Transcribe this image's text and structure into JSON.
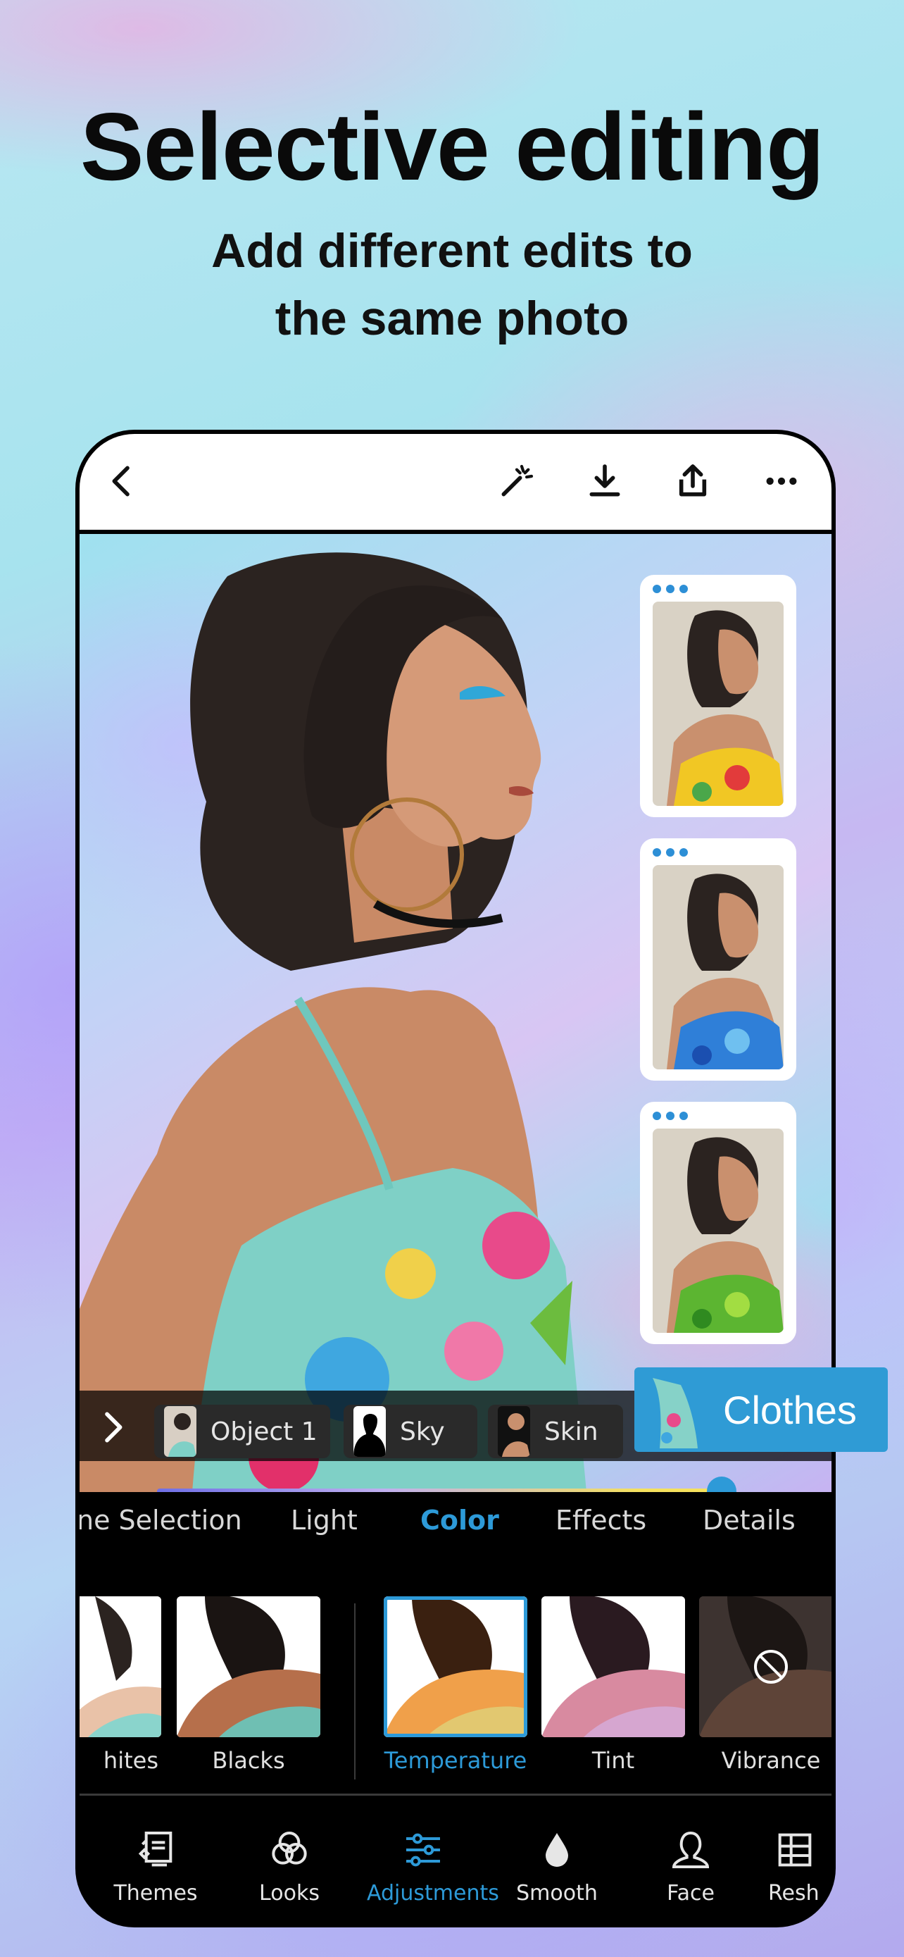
{
  "hero": {
    "title": "Selective editing",
    "subtitle_line1": "Add different edits to",
    "subtitle_line2": "the same photo"
  },
  "topbar": {
    "icons": [
      "back-icon",
      "magic-wand-icon",
      "download-icon",
      "share-icon",
      "more-icon"
    ]
  },
  "mask_chips": [
    {
      "label": "Object 1"
    },
    {
      "label": "Sky"
    },
    {
      "label": "Skin"
    }
  ],
  "selected_mask": {
    "label": "Clothes"
  },
  "tabs": [
    "ne Selection",
    "Light",
    "Color",
    "Effects",
    "Details"
  ],
  "active_tab": "Color",
  "tools": [
    {
      "label": "hites"
    },
    {
      "label": "Blacks"
    },
    {
      "label": "Temperature"
    },
    {
      "label": "Tint"
    },
    {
      "label": "Vibrance"
    }
  ],
  "active_tool": "Temperature",
  "bottom_nav": [
    {
      "label": "Themes",
      "icon": "themes-icon"
    },
    {
      "label": "Looks",
      "icon": "looks-icon"
    },
    {
      "label": "Adjustments",
      "icon": "adjustments-icon"
    },
    {
      "label": "Smooth",
      "icon": "smooth-icon"
    },
    {
      "label": "Face",
      "icon": "face-icon"
    },
    {
      "label": "Resh",
      "icon": "reshape-icon"
    }
  ],
  "active_nav": "Adjustments",
  "slider": {
    "value_fraction": 0.93
  },
  "colors": {
    "accent": "#2d9ad8",
    "pill": "#2f9bd5"
  }
}
